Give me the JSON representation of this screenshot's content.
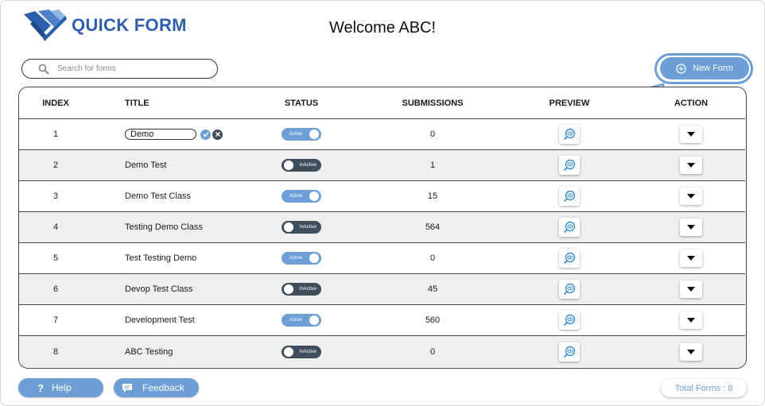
{
  "header": {
    "logo_text": "QUICK FORM",
    "welcome": "Welcome ABC!"
  },
  "search": {
    "placeholder": "Search for forms",
    "icon": "search-icon"
  },
  "new_form": {
    "label": "New Form",
    "icon": "plus-circle-icon",
    "accent": "#6d9fd6"
  },
  "table": {
    "headers": {
      "index": "INDEX",
      "title": "TITLE",
      "status": "STATUS",
      "submissions": "SUBMISSIONS",
      "preview": "PREVIEW",
      "action": "ACTION"
    },
    "rows": [
      {
        "index": "1",
        "title": "Demo",
        "editing": true,
        "status": "Active",
        "active": true,
        "submissions": "0"
      },
      {
        "index": "2",
        "title": "Demo Test",
        "status": "InActive",
        "active": false,
        "submissions": "1"
      },
      {
        "index": "3",
        "title": "Demo Test Class",
        "status": "Active",
        "active": true,
        "submissions": "15"
      },
      {
        "index": "4",
        "title": "Testing Demo Class",
        "status": "InActive",
        "active": false,
        "submissions": "564"
      },
      {
        "index": "5",
        "title": "Test Testing Demo",
        "status": "Active",
        "active": true,
        "submissions": "0"
      },
      {
        "index": "6",
        "title": "Devop Test Class",
        "status": "InActive",
        "active": false,
        "submissions": "45"
      },
      {
        "index": "7",
        "title": "Development Test",
        "status": "Active",
        "active": true,
        "submissions": "560"
      },
      {
        "index": "8",
        "title": "ABC Testing",
        "status": "InActive",
        "active": false,
        "submissions": "0"
      }
    ],
    "preview_icon": "eye-search-icon",
    "action_icon": "caret-down-icon"
  },
  "footer": {
    "help_label": "Help",
    "help_icon": "question-icon",
    "feedback_label": "Feedback",
    "feedback_icon": "chat-icon",
    "total_forms": "Total Forms : 8"
  },
  "colors": {
    "accent": "#6d9fd6",
    "inactive": "#3e4e5c",
    "logo": "#2e5fae"
  }
}
